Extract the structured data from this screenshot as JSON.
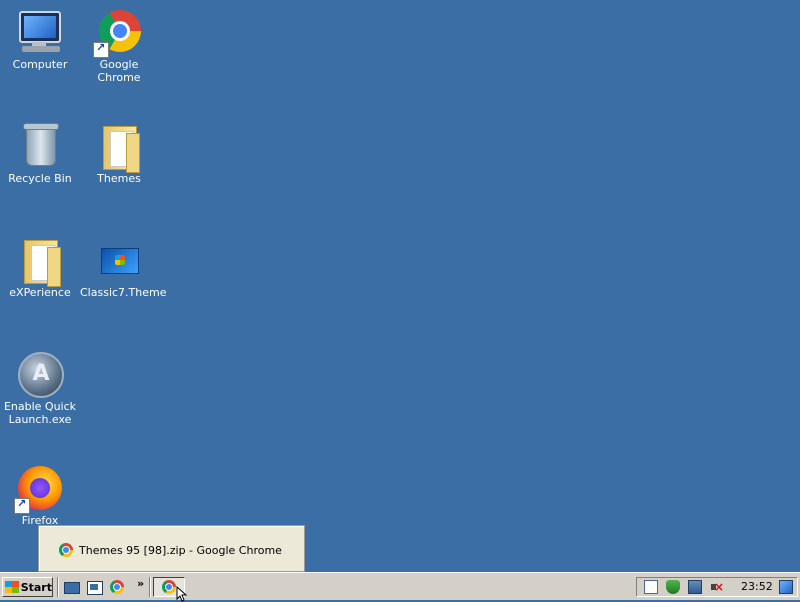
{
  "desktop": {
    "icons": [
      {
        "label": "Computer",
        "icon": "computer-icon"
      },
      {
        "label": "Google Chrome",
        "icon": "chrome-icon"
      },
      {
        "label": "Recycle Bin",
        "icon": "recycle-bin-icon"
      },
      {
        "label": "Themes",
        "icon": "folder-icon"
      },
      {
        "label": "eXPerience",
        "icon": "folder-icon"
      },
      {
        "label": "Classic7.Theme",
        "icon": "theme-file-icon"
      },
      {
        "label": "Enable Quick Launch.exe",
        "icon": "quick-launch-exe-icon"
      },
      {
        "label": "Firefox",
        "icon": "firefox-icon"
      }
    ]
  },
  "popup": {
    "item_label": "Themes 95 [98].zip - Google Chrome",
    "item_icon": "chrome-icon"
  },
  "taskbar": {
    "start_label": "Start",
    "chevron": "»",
    "quick_launch": [
      "show-desktop-icon",
      "explorer-icon",
      "chrome-icon"
    ],
    "active_task_icon": "chrome-icon",
    "tray_icons": [
      "document-icon",
      "security-shield-icon",
      "network-icon",
      "volume-muted-icon",
      "display-icon"
    ],
    "clock": "23:52"
  },
  "colors": {
    "desktop_background": "#3a6ea5",
    "taskbar_background": "#d4d0c8"
  }
}
